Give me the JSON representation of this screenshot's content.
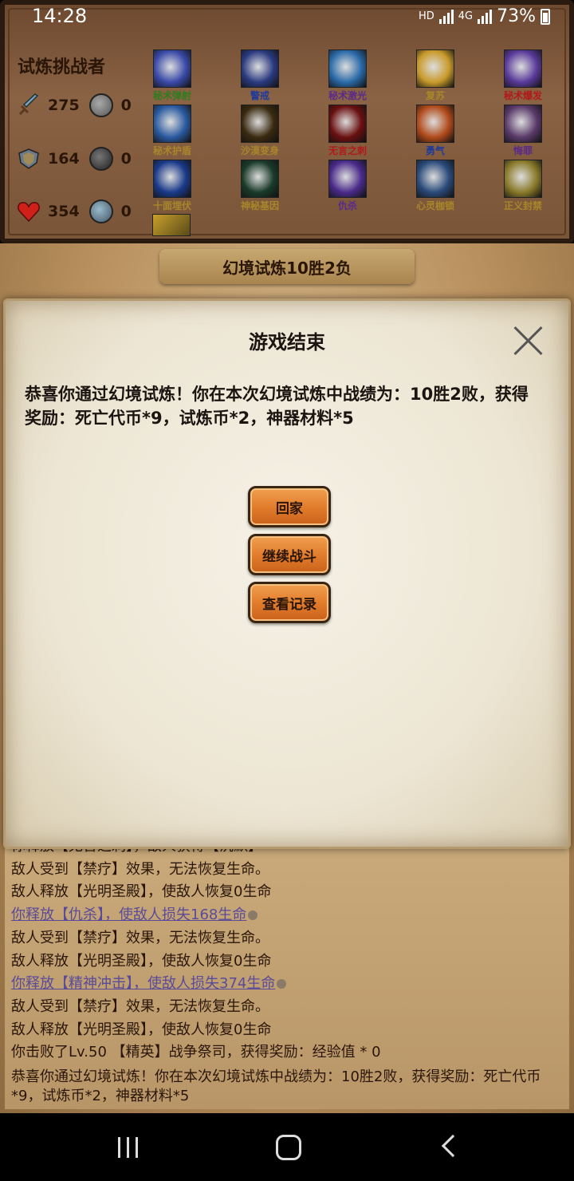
{
  "status_bar": {
    "time": "14:28",
    "hd": "HD",
    "network": "4G",
    "battery": "73%"
  },
  "player": {
    "title": "试炼挑战者",
    "stats": [
      {
        "icon": "sword-icon",
        "value": "275",
        "coin_value": "0"
      },
      {
        "icon": "shield-icon",
        "value": "164",
        "coin_value": "0"
      },
      {
        "icon": "heart-icon",
        "value": "354",
        "coin_value": "0"
      }
    ]
  },
  "skills": [
    {
      "name": "秘术弹射",
      "color": "#2e7d1e",
      "icon_color": "#3a4aa8"
    },
    {
      "name": "警戒",
      "color": "#1f3a9a",
      "icon_color": "#2a3a80"
    },
    {
      "name": "秘术激光",
      "color": "#5a2a8a",
      "icon_color": "#2a6aa8"
    },
    {
      "name": "复苏",
      "color": "#a8862a",
      "icon_color": "#c89a2a"
    },
    {
      "name": "秘术爆发",
      "color": "#b01a1a",
      "icon_color": "#5a3a9a"
    },
    {
      "name": "秘术护盾",
      "color": "#a8862a",
      "icon_color": "#2a5aa0"
    },
    {
      "name": "沙漠变身",
      "color": "#a8862a",
      "icon_color": "#3a2a10"
    },
    {
      "name": "无言之刺",
      "color": "#b01a1a",
      "icon_color": "#6a1010"
    },
    {
      "name": "勇气",
      "color": "#1f3a9a",
      "icon_color": "#b04a1a"
    },
    {
      "name": "悔罪",
      "color": "#5a2a8a",
      "icon_color": "#5a3a6a"
    },
    {
      "name": "十面埋伏",
      "color": "#a8862a",
      "icon_color": "#1a3a8a"
    },
    {
      "name": "神秘基因",
      "color": "#a8862a",
      "icon_color": "#1a3a2a"
    },
    {
      "name": "仇杀",
      "color": "#5a2a8a",
      "icon_color": "#4a2a8a"
    },
    {
      "name": "心灵枷锁",
      "color": "#a8862a",
      "icon_color": "#2a4a7a"
    },
    {
      "name": "正义封禁",
      "color": "#a8862a",
      "icon_color": "#8a7a2a"
    }
  ],
  "battle_title": "幻境试炼10胜2负",
  "dialog": {
    "title": "游戏结束",
    "message": "恭喜你通过幻境试炼！你在本次幻境试炼中战绩为：10胜2败，获得奖励：死亡代币*9，试炼币*2，神器材料*5",
    "buttons": [
      "回家",
      "继续战斗",
      "查看记录"
    ]
  },
  "log": [
    {
      "text": "你释放【无言之刺】，敌人获得【沉默】",
      "type": "normal"
    },
    {
      "text": "敌人受到【禁疗】效果，无法恢复生命。",
      "type": "normal"
    },
    {
      "text": "敌人释放【光明圣殿】，使敌人恢复0生命",
      "type": "normal"
    },
    {
      "text": "你释放【仇杀】，使敌人损失168生命",
      "type": "player"
    },
    {
      "text": "敌人受到【禁疗】效果，无法恢复生命。",
      "type": "normal"
    },
    {
      "text": "敌人释放【光明圣殿】，使敌人恢复0生命",
      "type": "normal"
    },
    {
      "text": "你释放【精神冲击】，使敌人损失374生命",
      "type": "player"
    },
    {
      "text": "敌人受到【禁疗】效果，无法恢复生命。",
      "type": "normal"
    },
    {
      "text": "敌人释放【光明圣殿】，使敌人恢复0生命",
      "type": "normal"
    },
    {
      "text": "你击败了Lv.50 【精英】战争祭司，获得奖励：经验值 * 0",
      "type": "normal"
    },
    {
      "text": "恭喜你通过幻境试炼！你在本次幻境试炼中战绩为：10胜2败，获得奖励：死亡代币*9，试炼币*2，神器材料*5",
      "type": "multi"
    }
  ]
}
